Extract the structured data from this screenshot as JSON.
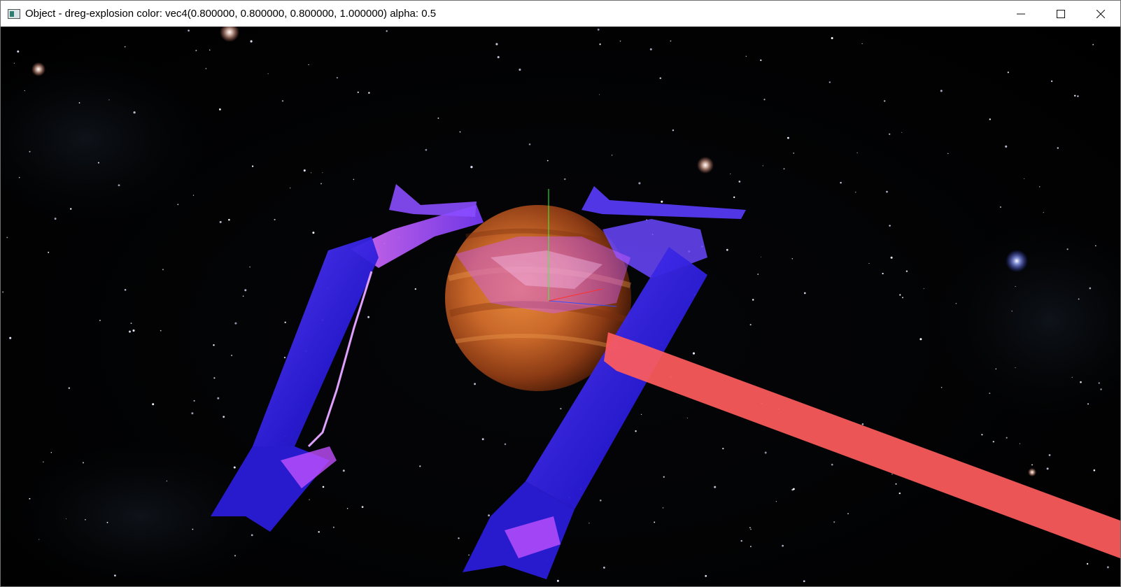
{
  "window": {
    "title": "Object - dreg-explosion color: vec4(0.800000, 0.800000, 0.800000, 1.000000) alpha: 0.5",
    "app_icon": "application-window-icon",
    "controls": {
      "minimize": "minimize-icon",
      "maximize": "maximize-icon",
      "close": "close-icon"
    }
  },
  "scene": {
    "background": "#000000",
    "planet_color": "#c9682a",
    "beam_color": "#ff5c5c",
    "ship_color": "#3a2cff",
    "ship_glow_color": "#d65cff",
    "axis_x_color": "#ff3030",
    "axis_y_color": "#30ff30",
    "axis_z_color": "#3050ff"
  }
}
